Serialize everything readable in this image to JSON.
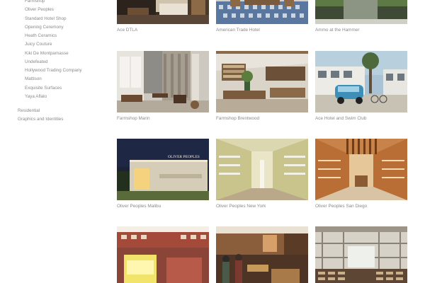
{
  "sidebar": {
    "sub_items": [
      "Farmshop",
      "Oliver Peoples",
      "Standard Hotel Shop",
      "Opening Ceremony",
      "Heath Ceramics",
      "Juicy Couture",
      "Kiki De Montparnasse",
      "Undefeated",
      "Hollywood Trading Company",
      "Mattison",
      "Exquisite Surfaces",
      "Yaya Aflalo"
    ],
    "top_items": [
      "Residential",
      "Graphics and Identities"
    ]
  },
  "projects": [
    {
      "caption": "Ace DTLA"
    },
    {
      "caption": "American Trade Hotel"
    },
    {
      "caption": "Ammo at the Hammer"
    },
    {
      "caption": "Farmshop Marin"
    },
    {
      "caption": "Farmshop Brentwood"
    },
    {
      "caption": "Ace Hotel and Swim Club"
    },
    {
      "caption": "Oliver Peoples Malibu"
    },
    {
      "caption": "Oliver Peoples New York"
    },
    {
      "caption": "Oliver Peoples San Diego"
    },
    {
      "caption": ""
    },
    {
      "caption": ""
    },
    {
      "caption": ""
    }
  ],
  "photo_signs": {
    "malibu_sign": "OLIVER PEOPLES"
  },
  "colors": {
    "text_gray": "#8a8a8a",
    "background": "#ffffff"
  }
}
